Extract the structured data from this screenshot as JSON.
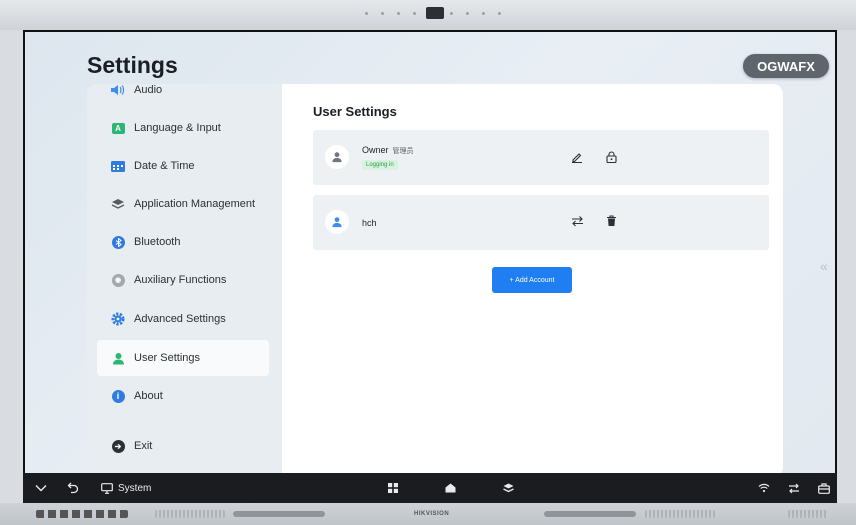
{
  "page": {
    "title": "Settings",
    "account_chip": "OGWAFX"
  },
  "sidebar": {
    "items": [
      {
        "label": "Audio",
        "icon": "speaker-icon",
        "color": "#3d8ef0"
      },
      {
        "label": "Language & Input",
        "icon": "language-icon",
        "color": "#2bb673"
      },
      {
        "label": "Date & Time",
        "icon": "calendar-icon",
        "color": "#2f7be0"
      },
      {
        "label": "Application Management",
        "icon": "layers-icon",
        "color": "#555c63"
      },
      {
        "label": "Bluetooth",
        "icon": "bluetooth-icon",
        "color": "#2f7be0"
      },
      {
        "label": "Auxiliary Functions",
        "icon": "auxiliary-icon",
        "color": "#8a9097"
      },
      {
        "label": "Advanced Settings",
        "icon": "gear-icon",
        "color": "#2f7be0"
      },
      {
        "label": "User Settings",
        "icon": "user-icon",
        "color": "#2bb673",
        "active": true
      },
      {
        "label": "About",
        "icon": "info-icon",
        "color": "#2f7be0"
      },
      {
        "label": "Exit",
        "icon": "exit-icon",
        "color": "#2b3036"
      }
    ]
  },
  "content": {
    "title": "User Settings",
    "users": [
      {
        "name": "Owner",
        "role": "管理员",
        "status": "Logging in",
        "actions": [
          "edit-icon",
          "lock-icon"
        ]
      },
      {
        "name": "hch",
        "role": "",
        "status": "",
        "actions": [
          "switch-icon",
          "delete-icon"
        ]
      }
    ],
    "add_button": "+ Add Account"
  },
  "taskbar": {
    "system_label": "System"
  },
  "bezel": {
    "brand": "HIKVISION"
  },
  "colors": {
    "accent": "#1e7ef2",
    "success": "#2aa04a",
    "taskbar": "#1a1c1f"
  }
}
